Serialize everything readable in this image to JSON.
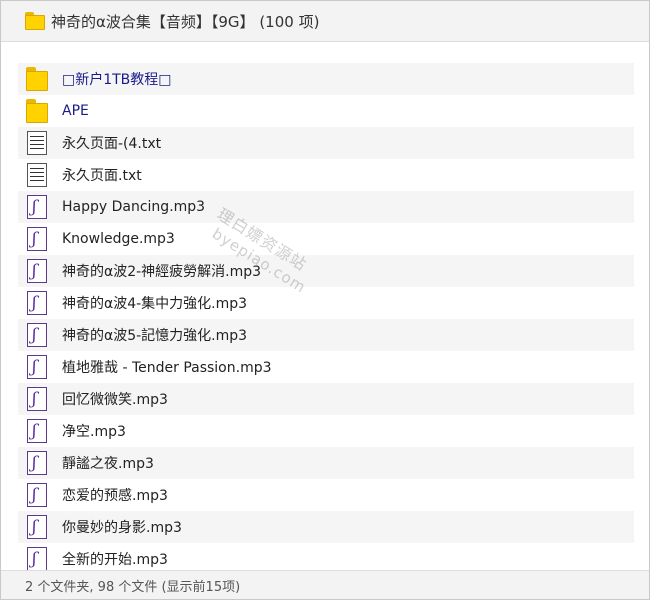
{
  "header": {
    "title": "神奇的α波合集【音频】【9G】 (100 项)",
    "icon": "folder-icon"
  },
  "files": [
    {
      "name": "□新户1TB教程□",
      "type": "folder"
    },
    {
      "name": "APE",
      "type": "folder"
    },
    {
      "name": "永久页面-(4.txt",
      "type": "txt"
    },
    {
      "name": "永久页面.txt",
      "type": "txt"
    },
    {
      "name": "Happy Dancing.mp3",
      "type": "mp3"
    },
    {
      "name": "Knowledge.mp3",
      "type": "mp3"
    },
    {
      "name": "神奇的α波2-神經疲勞解消.mp3",
      "type": "mp3"
    },
    {
      "name": "神奇的α波4-集中力強化.mp3",
      "type": "mp3"
    },
    {
      "name": "神奇的α波5-記憶力強化.mp3",
      "type": "mp3"
    },
    {
      "name": "植地雅哉 - Tender Passion.mp3",
      "type": "mp3"
    },
    {
      "name": "回忆微微笑.mp3",
      "type": "mp3"
    },
    {
      "name": "净空.mp3",
      "type": "mp3"
    },
    {
      "name": "靜謐之夜.mp3",
      "type": "mp3"
    },
    {
      "name": "恋爱的预感.mp3",
      "type": "mp3"
    },
    {
      "name": "你曼妙的身影.mp3",
      "type": "mp3"
    },
    {
      "name": "全新的开始.mp3",
      "type": "mp3"
    }
  ],
  "watermark": {
    "line1": "理白嫖资源站",
    "line2": "byepiao.com"
  },
  "footer": {
    "status": "2 个文件夹, 98 个文件 (显示前15项)"
  },
  "colors": {
    "folder": "#ffd200",
    "folder_name": "#1a1a8c",
    "mp3_icon": "#5a2ca0",
    "header_bg": "#f3f3f3",
    "row_alt_bg": "#f5f5f5"
  }
}
